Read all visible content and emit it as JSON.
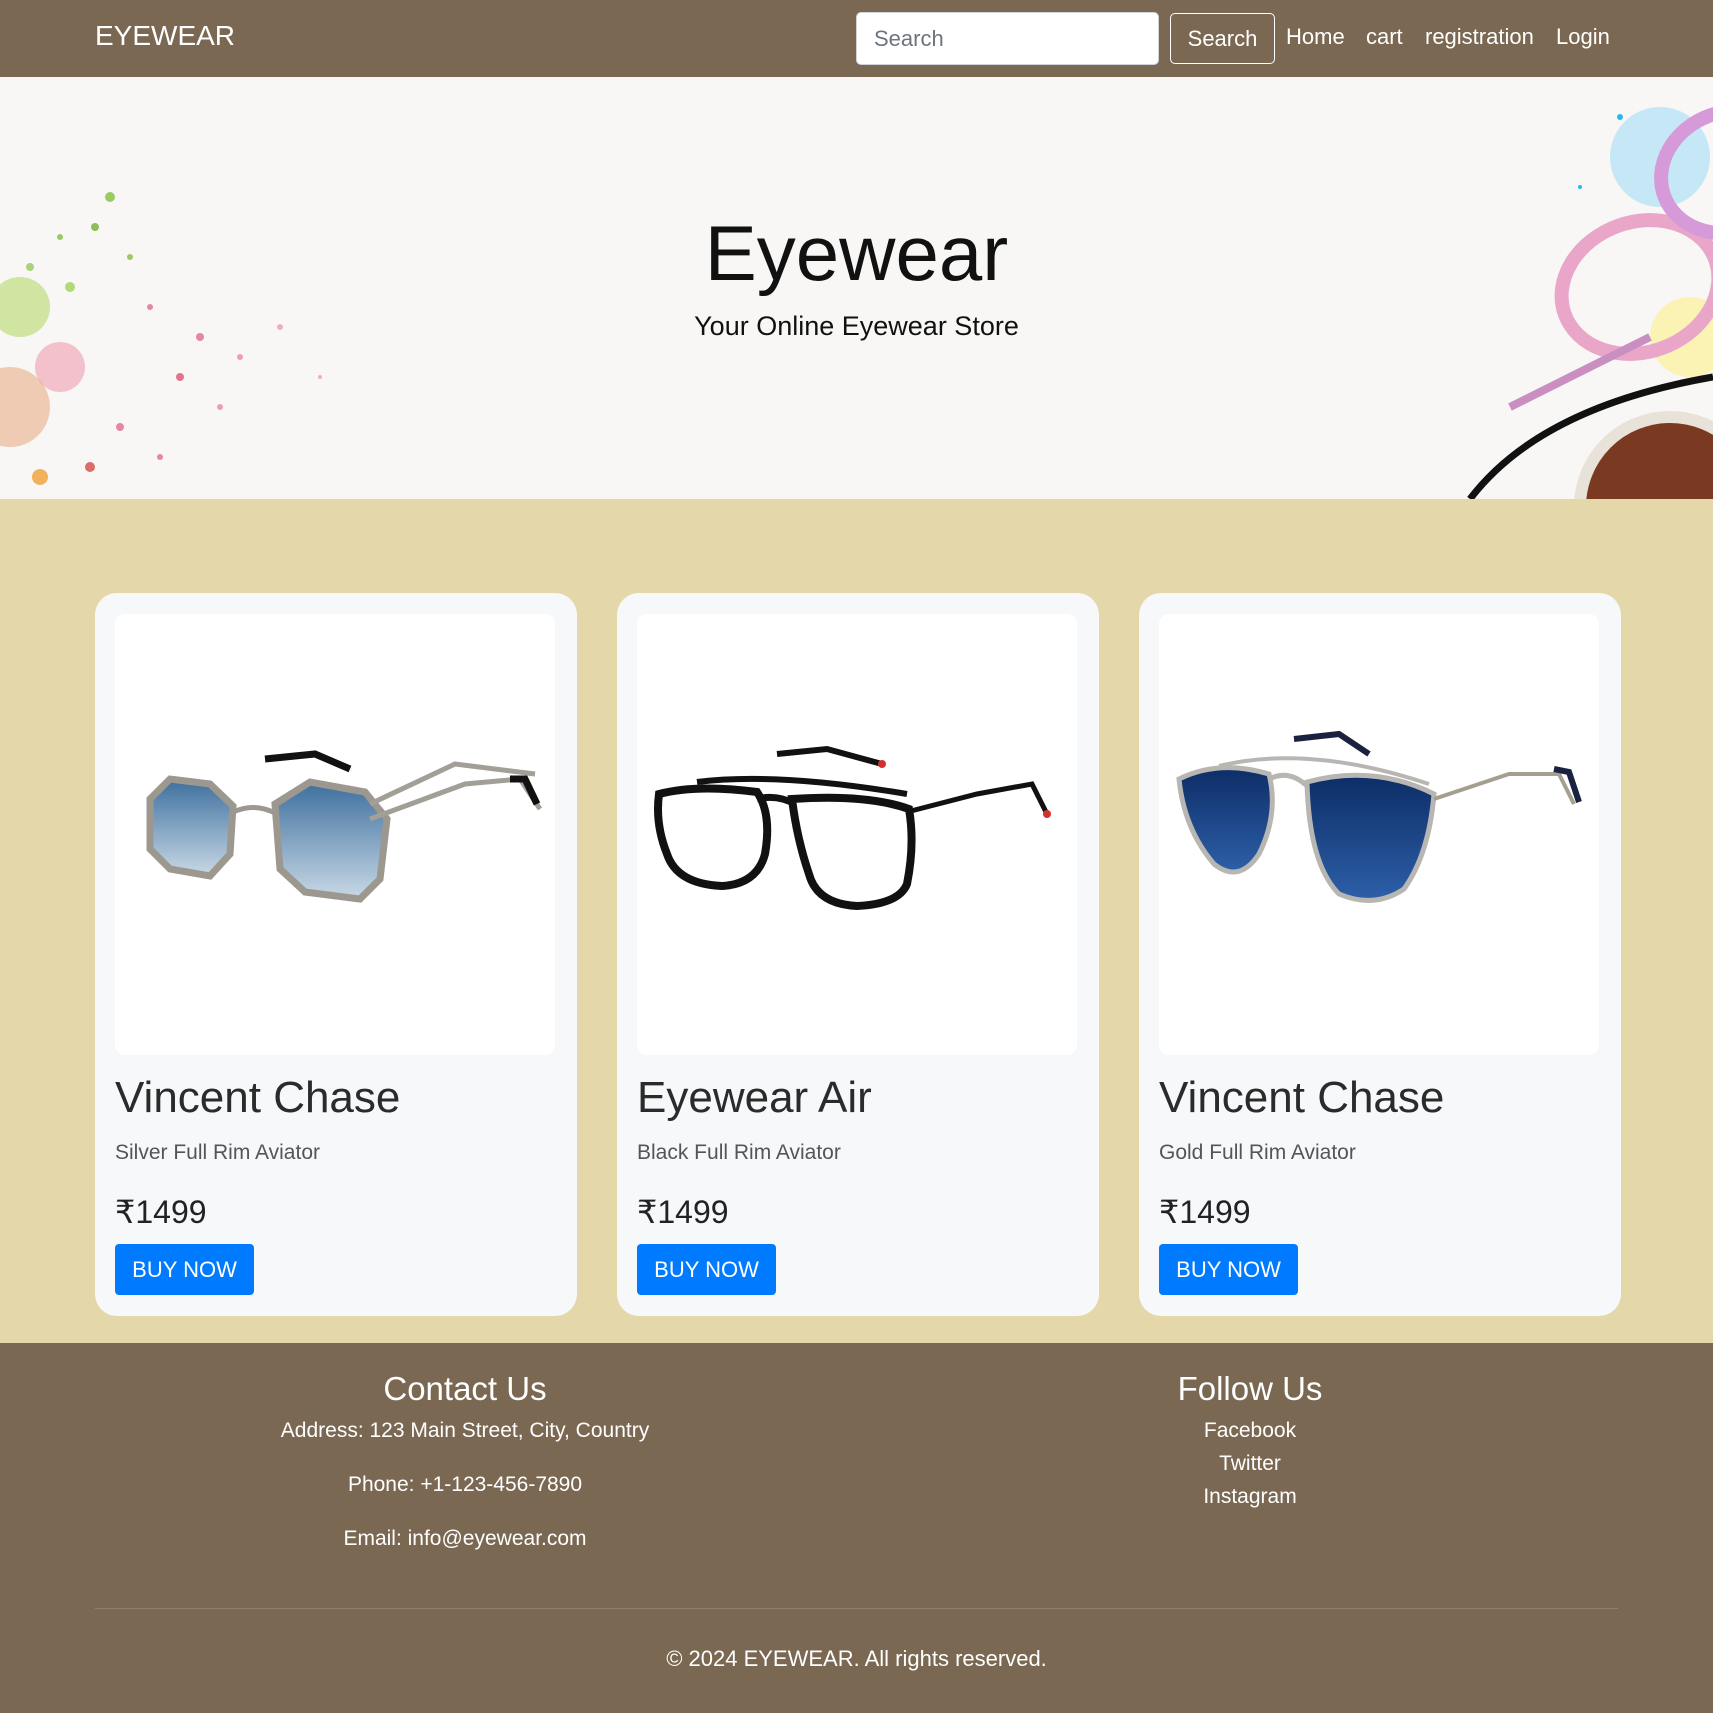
{
  "nav": {
    "brand": "EYEWEAR",
    "search_placeholder": "Search",
    "search_button": "Search",
    "links": [
      "Home",
      "cart",
      "registration",
      "Login"
    ]
  },
  "hero": {
    "title": "Eyewear",
    "subtitle": "Your Online Eyewear Store"
  },
  "products": [
    {
      "name": "Vincent Chase",
      "desc": "Silver Full Rim Aviator",
      "price": "₹1499",
      "button": "BUY NOW",
      "image": "hexagonal-blue-gradient-sunglasses"
    },
    {
      "name": "Eyewear Air",
      "desc": "Black Full Rim Aviator",
      "price": "₹1499",
      "button": "BUY NOW",
      "image": "black-double-bridge-eyeglasses"
    },
    {
      "name": "Vincent Chase",
      "desc": "Gold Full Rim Aviator",
      "price": "₹1499",
      "button": "BUY NOW",
      "image": "blue-aviator-sunglasses"
    }
  ],
  "footer": {
    "contact_heading": "Contact Us",
    "address": "Address: 123 Main Street, City, Country",
    "phone": "Phone: +1-123-456-7890",
    "email": "Email: info@eyewear.com",
    "follow_heading": "Follow Us",
    "social": [
      "Facebook",
      "Twitter",
      "Instagram"
    ],
    "copyright": "© 2024 EYEWEAR. All rights reserved."
  },
  "colors": {
    "nav_bg": "#7a6852",
    "page_bg": "#e4d7aa",
    "accent": "#007bff",
    "card_bg": "#f6f8fa"
  }
}
